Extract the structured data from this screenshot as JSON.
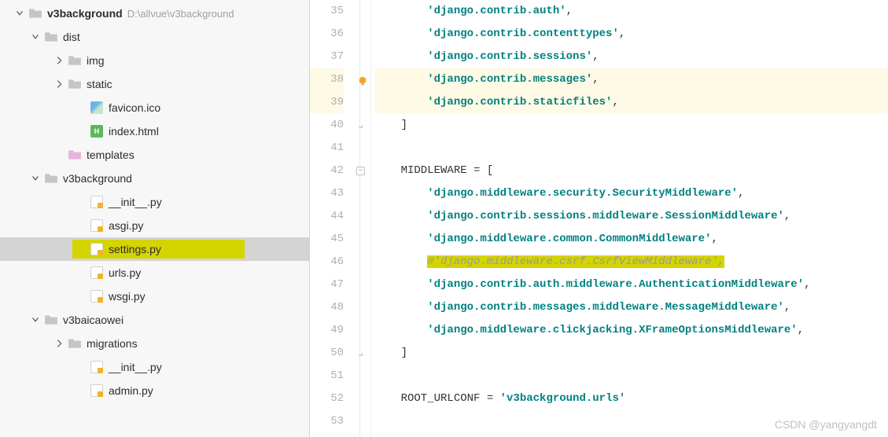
{
  "project": {
    "root_name": "v3background",
    "root_path": "D:\\allvue\\v3background"
  },
  "tree": [
    {
      "label": "v3background",
      "bold": true,
      "indent": 0,
      "chevron": "down",
      "icon": "folder",
      "path": "D:\\allvue\\v3background"
    },
    {
      "label": "dist",
      "indent": 1,
      "chevron": "down",
      "icon": "folder"
    },
    {
      "label": "img",
      "indent": 2,
      "chevron": "right",
      "icon": "folder"
    },
    {
      "label": "static",
      "indent": 2,
      "chevron": "right",
      "icon": "folder"
    },
    {
      "label": "favicon.ico",
      "indent": 3,
      "chevron": "none",
      "icon": "ico"
    },
    {
      "label": "index.html",
      "indent": 3,
      "chevron": "none",
      "icon": "html"
    },
    {
      "label": "templates",
      "indent": 2,
      "chevron": "none",
      "icon": "folder-pink"
    },
    {
      "label": "v3background",
      "indent": 1,
      "chevron": "down",
      "icon": "folder"
    },
    {
      "label": "__init__.py",
      "indent": 3,
      "chevron": "none",
      "icon": "py"
    },
    {
      "label": "asgi.py",
      "indent": 3,
      "chevron": "none",
      "icon": "py"
    },
    {
      "label": "settings.py",
      "indent": 3,
      "chevron": "none",
      "icon": "py",
      "selected": true,
      "highlight": true
    },
    {
      "label": "urls.py",
      "indent": 3,
      "chevron": "none",
      "icon": "py"
    },
    {
      "label": "wsgi.py",
      "indent": 3,
      "chevron": "none",
      "icon": "py"
    },
    {
      "label": "v3baicaowei",
      "indent": 1,
      "chevron": "down",
      "icon": "folder"
    },
    {
      "label": "migrations",
      "indent": 2,
      "chevron": "right",
      "icon": "folder"
    },
    {
      "label": "__init__.py",
      "indent": 3,
      "chevron": "none",
      "icon": "py"
    },
    {
      "label": "admin.py",
      "indent": 3,
      "chevron": "none",
      "icon": "py"
    }
  ],
  "gutter_start": 35,
  "gutter_end": 53,
  "code": [
    {
      "n": 35,
      "seg": [
        {
          "t": "        ",
          "c": ""
        },
        {
          "t": "'django.contrib.auth'",
          "c": "str"
        },
        {
          "t": ",",
          "c": "kw"
        }
      ]
    },
    {
      "n": 36,
      "seg": [
        {
          "t": "        ",
          "c": ""
        },
        {
          "t": "'django.contrib.contenttypes'",
          "c": "str"
        },
        {
          "t": ",",
          "c": "kw"
        }
      ]
    },
    {
      "n": 37,
      "seg": [
        {
          "t": "        ",
          "c": ""
        },
        {
          "t": "'django.contrib.sessions'",
          "c": "str"
        },
        {
          "t": ",",
          "c": "kw"
        }
      ]
    },
    {
      "n": 38,
      "hl": "light",
      "bulb": true,
      "seg": [
        {
          "t": "        ",
          "c": ""
        },
        {
          "t": "'django.contrib.messages'",
          "c": "str"
        },
        {
          "t": ",",
          "c": "kw"
        }
      ]
    },
    {
      "n": 39,
      "hl": "light",
      "seg": [
        {
          "t": "        ",
          "c": ""
        },
        {
          "t": "'django.contrib.staticfiles'",
          "c": "str"
        },
        {
          "t": ",",
          "c": "kw"
        }
      ]
    },
    {
      "n": 40,
      "fold": "end",
      "seg": [
        {
          "t": "    ]",
          "c": "kw"
        }
      ]
    },
    {
      "n": 41,
      "seg": [
        {
          "t": "",
          "c": ""
        }
      ]
    },
    {
      "n": 42,
      "fold": "start",
      "seg": [
        {
          "t": "    MIDDLEWARE = [",
          "c": "kw"
        }
      ]
    },
    {
      "n": 43,
      "seg": [
        {
          "t": "        ",
          "c": ""
        },
        {
          "t": "'django.middleware.security.SecurityMiddleware'",
          "c": "str"
        },
        {
          "t": ",",
          "c": "kw"
        }
      ]
    },
    {
      "n": 44,
      "seg": [
        {
          "t": "        ",
          "c": ""
        },
        {
          "t": "'django.contrib.sessions.middleware.SessionMiddleware'",
          "c": "str"
        },
        {
          "t": ",",
          "c": "kw"
        }
      ]
    },
    {
      "n": 45,
      "seg": [
        {
          "t": "        ",
          "c": ""
        },
        {
          "t": "'django.middleware.common.CommonMiddleware'",
          "c": "str"
        },
        {
          "t": ",",
          "c": "kw"
        }
      ]
    },
    {
      "n": 46,
      "seg": [
        {
          "t": "        ",
          "c": ""
        },
        {
          "t": "#'django.middleware.csrf.CsrfViewMiddleware',",
          "c": "comment",
          "hl": true
        }
      ]
    },
    {
      "n": 47,
      "seg": [
        {
          "t": "        ",
          "c": ""
        },
        {
          "t": "'django.contrib.auth.middleware.AuthenticationMiddleware'",
          "c": "str"
        },
        {
          "t": ",",
          "c": "kw"
        }
      ]
    },
    {
      "n": 48,
      "seg": [
        {
          "t": "        ",
          "c": ""
        },
        {
          "t": "'django.contrib.messages.middleware.MessageMiddleware'",
          "c": "str"
        },
        {
          "t": ",",
          "c": "kw"
        }
      ]
    },
    {
      "n": 49,
      "seg": [
        {
          "t": "        ",
          "c": ""
        },
        {
          "t": "'django.middleware.clickjacking.XFrameOptionsMiddleware'",
          "c": "str"
        },
        {
          "t": ",",
          "c": "kw"
        }
      ]
    },
    {
      "n": 50,
      "fold": "end",
      "seg": [
        {
          "t": "    ]",
          "c": "kw"
        }
      ]
    },
    {
      "n": 51,
      "seg": [
        {
          "t": "",
          "c": ""
        }
      ]
    },
    {
      "n": 52,
      "seg": [
        {
          "t": "    ROOT_URLCONF = ",
          "c": "kw"
        },
        {
          "t": "'v3background.urls'",
          "c": "str"
        }
      ]
    },
    {
      "n": 53,
      "seg": [
        {
          "t": "",
          "c": ""
        }
      ]
    }
  ],
  "watermark": "CSDN @yangyangdt"
}
